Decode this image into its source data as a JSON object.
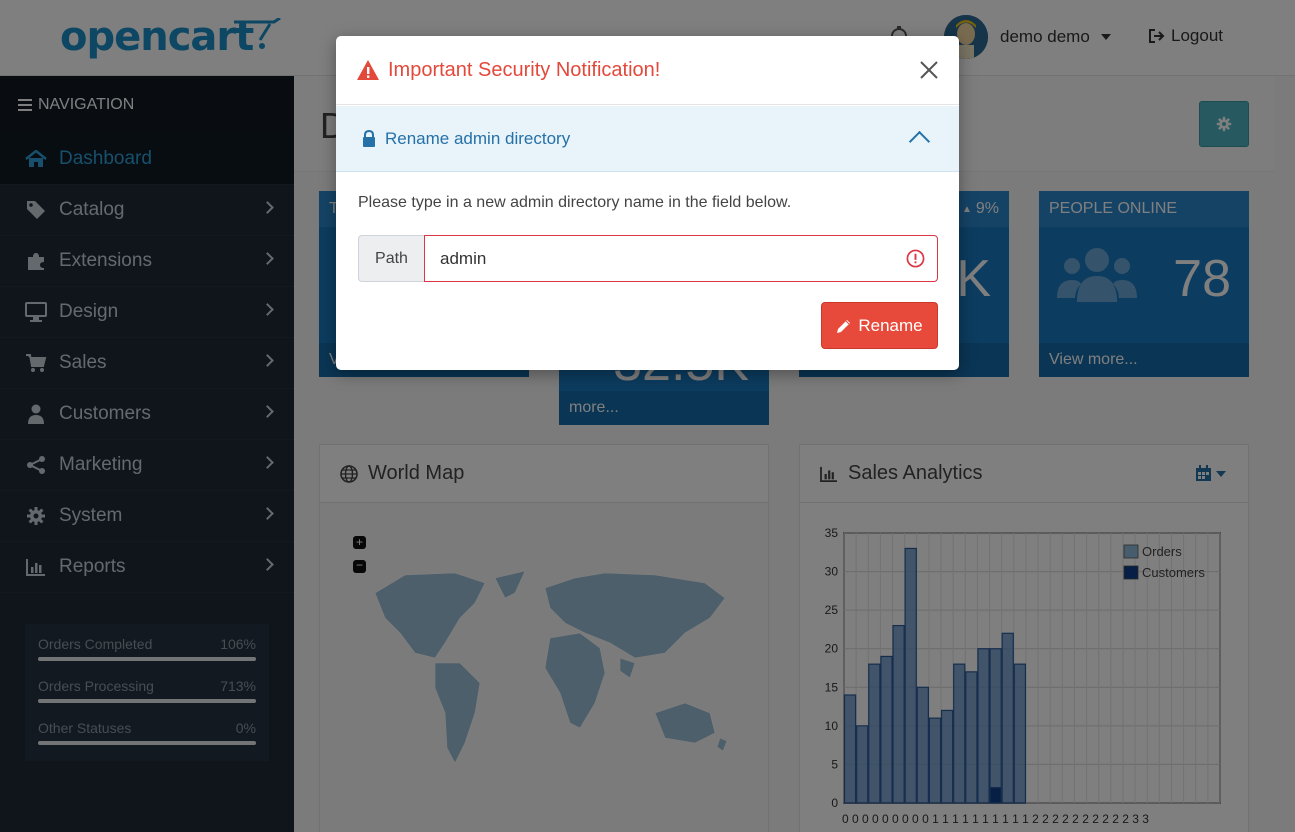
{
  "header": {
    "logo_text": "opencart",
    "user_name": "demo demo",
    "logout_label": "Logout"
  },
  "sidebar": {
    "title": "NAVIGATION",
    "items": [
      {
        "label": "Dashboard",
        "icon": "home-icon",
        "active": true
      },
      {
        "label": "Catalog",
        "icon": "tag-icon"
      },
      {
        "label": "Extensions",
        "icon": "puzzle-icon"
      },
      {
        "label": "Design",
        "icon": "monitor-icon"
      },
      {
        "label": "Sales",
        "icon": "cart-icon"
      },
      {
        "label": "Customers",
        "icon": "user-icon"
      },
      {
        "label": "Marketing",
        "icon": "share-icon"
      },
      {
        "label": "System",
        "icon": "gear-icon"
      },
      {
        "label": "Reports",
        "icon": "bar-chart-icon"
      }
    ],
    "stats": [
      {
        "label": "Orders Completed",
        "value": "106%",
        "fill": 1.0
      },
      {
        "label": "Orders Processing",
        "value": "713%",
        "fill": 1.0
      },
      {
        "label": "Other Statuses",
        "value": "0%",
        "fill": 1.0
      }
    ]
  },
  "dashboard": {
    "title_fragment": "D",
    "tiles": [
      {
        "top": "T",
        "foot": "V"
      },
      {
        "big": "32.5K",
        "foot": "more..."
      },
      {
        "top": "9%",
        "big": "K"
      },
      {
        "top": "PEOPLE ONLINE",
        "big": "78",
        "foot": "View more..."
      }
    ],
    "world_map_title": "World Map",
    "sales_title": "Sales Analytics"
  },
  "chart_data": {
    "type": "bar",
    "title": "",
    "series": [
      {
        "name": "Orders",
        "values": [
          14,
          10,
          18,
          19,
          23,
          33,
          15,
          11,
          12,
          18,
          17,
          20,
          20,
          22,
          18,
          0,
          0,
          0,
          0,
          0,
          0,
          0,
          0,
          0,
          0,
          0,
          0,
          0,
          0,
          0,
          0
        ]
      },
      {
        "name": "Customers",
        "values": [
          0,
          0,
          0,
          0,
          0,
          0,
          0,
          0,
          0,
          0,
          0,
          0,
          2,
          0,
          0,
          0,
          0,
          0,
          0,
          0,
          0,
          0,
          0,
          0,
          0,
          0,
          0,
          0,
          0,
          0,
          0
        ]
      }
    ],
    "yticks": [
      0,
      5,
      10,
      15,
      20,
      25,
      30,
      35
    ],
    "ylim": [
      0,
      35
    ],
    "xtick_row1": "0 0 0 0 0 0 0 0 0 1 1 1 1 1 1 1 1 1 1 2 2 2 2 2 2 2 2 2 2 3 3",
    "legend_position": "top-right",
    "colors": {
      "orders": "#8fb8d9",
      "customers": "#0f3d8a"
    }
  },
  "modal": {
    "title": "Important Security Notification!",
    "section_label": "Rename admin directory",
    "description": "Please type in a new admin directory name in the field below.",
    "path_label": "Path",
    "path_value": "admin",
    "rename_label": "Rename",
    "colors": {
      "danger": "#e2493b",
      "accent": "#2571a8"
    }
  }
}
